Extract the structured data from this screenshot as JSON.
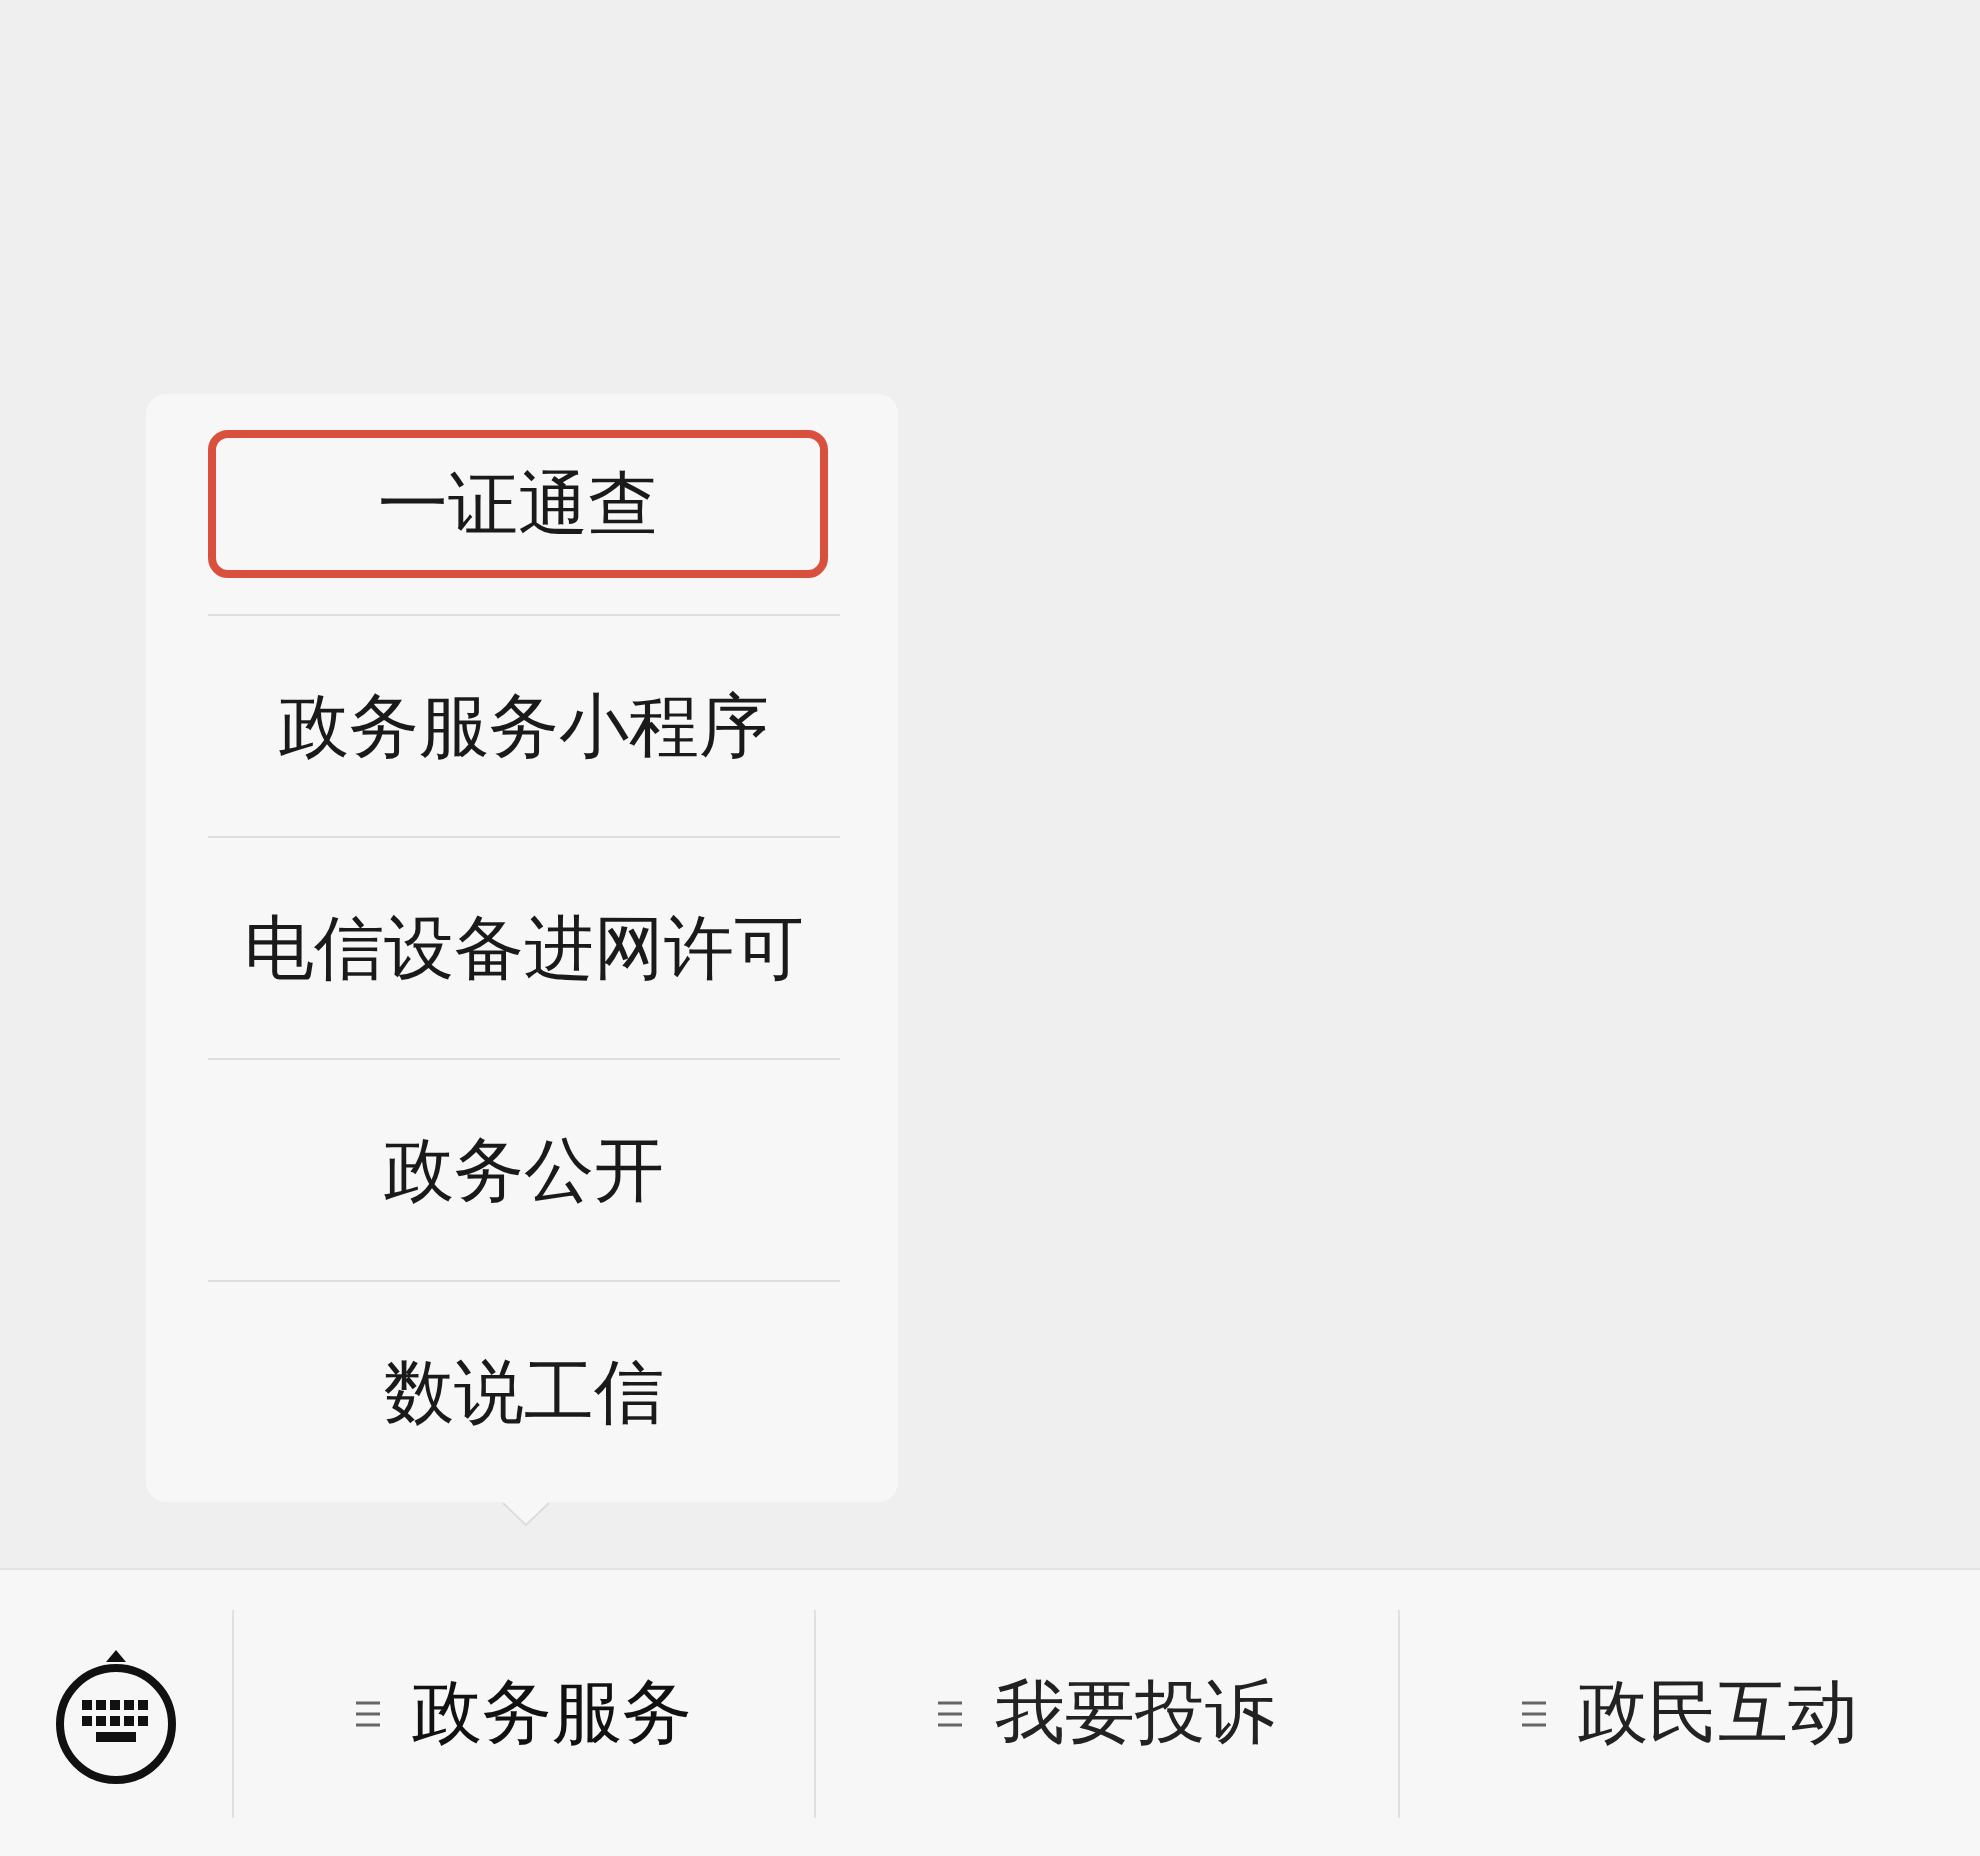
{
  "popup_menu": {
    "items": [
      {
        "label": "一证通查",
        "highlighted": true
      },
      {
        "label": "政务服务小程序",
        "highlighted": false
      },
      {
        "label": "电信设备进网许可",
        "highlighted": false
      },
      {
        "label": "政务公开",
        "highlighted": false
      },
      {
        "label": "数说工信",
        "highlighted": false
      }
    ]
  },
  "menu_bar": {
    "items": [
      {
        "label": "政务服务",
        "selected": true
      },
      {
        "label": "我要投诉",
        "selected": false
      },
      {
        "label": "政民互动",
        "selected": false
      }
    ]
  }
}
